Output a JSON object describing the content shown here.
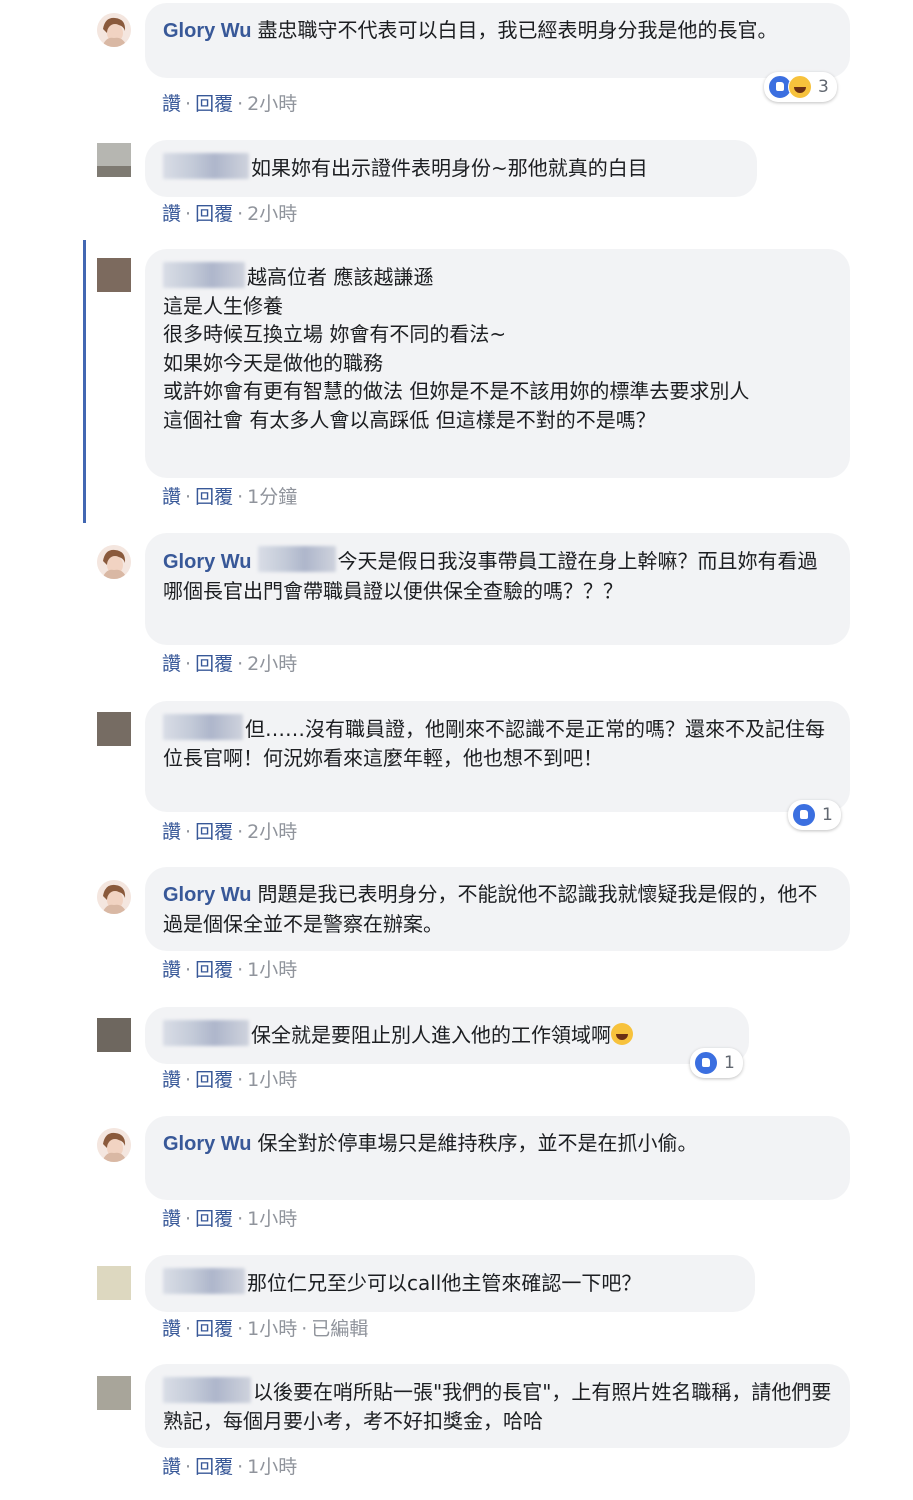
{
  "actions": {
    "like": "讚",
    "reply": "回覆",
    "edited": "已編輯"
  },
  "comments": [
    {
      "author": "Glory Wu",
      "text": "盡忠職守不代表可以白目，我已經表明身分我是他的長官。",
      "time": "2小時",
      "reaction_count": "3"
    },
    {
      "author": "",
      "text": "如果妳有出示證件表明身份~那他就真的白目",
      "time": "2小時"
    },
    {
      "author": "",
      "text": "越高位者 應該越謙遜\n這是人生修養\n很多時候互換立場 妳會有不同的看法~\n如果妳今天是做他的職務\n或許妳會有更有智慧的做法 但妳是不是不該用妳的標準去要求別人\n這個社會 有太多人會以高踩低 但這樣是不對的不是嗎？",
      "time": "1分鐘"
    },
    {
      "author": "Glory Wu",
      "text": "今天是假日我沒事帶員工證在身上幹嘛？而且妳有看過哪個長官出門會帶職員證以便供保全查驗的嗎？？？",
      "time": "2小時"
    },
    {
      "author": "",
      "text": "但……沒有職員證，他剛來不認識不是正常的嗎？還來不及記住每位長官啊！何況妳看來這麼年輕，他也想不到吧！",
      "time": "2小時",
      "reaction_count": "1"
    },
    {
      "author": "Glory Wu",
      "text": "問題是我已表明身分，不能說他不認識我就懷疑我是假的，他不過是個保全並不是警察在辦案。",
      "time": "1小時"
    },
    {
      "author": "",
      "text": "保全就是要阻止別人進入他的工作領域啊",
      "time": "1小時",
      "reaction_count": "1"
    },
    {
      "author": "Glory Wu",
      "text": "保全對於停車場只是維持秩序，並不是在抓小偷。",
      "time": "1小時"
    },
    {
      "author": "",
      "text": "那位仁兄至少可以call他主管來確認一下吧？",
      "time": "1小時",
      "edited": true
    },
    {
      "author": "",
      "text": "以後要在哨所貼一張\"我們的長官\"，上有照片姓名職稱，請他們要熟記，每個月要小考，考不好扣獎金，哈哈",
      "time": "1小時"
    }
  ]
}
